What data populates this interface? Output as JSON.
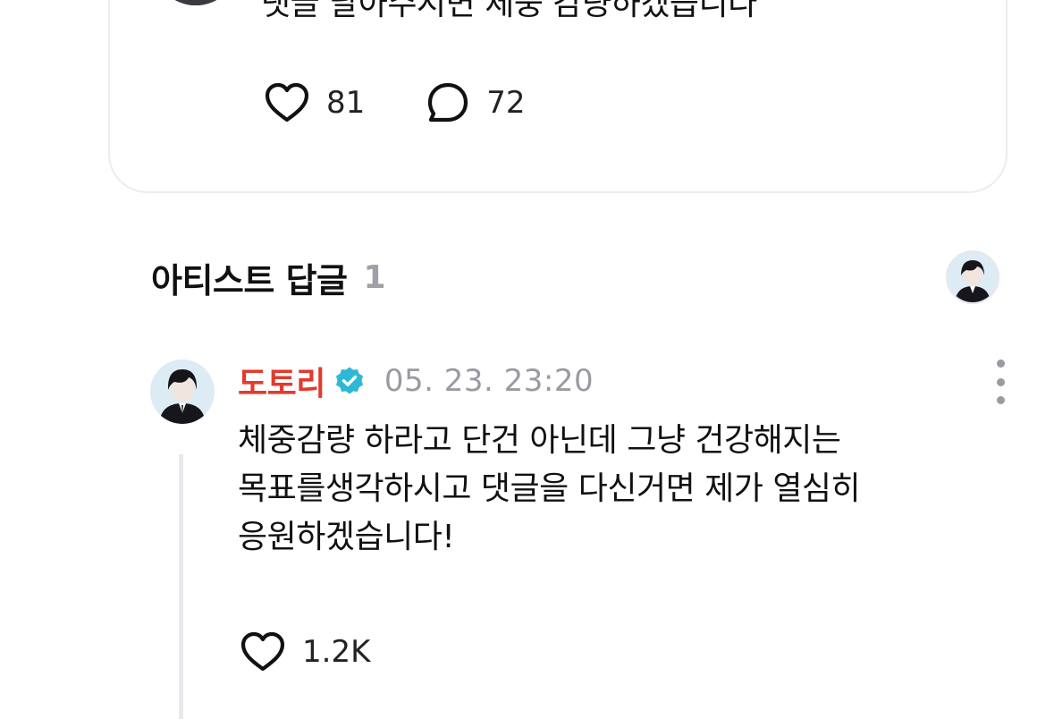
{
  "post": {
    "text": "댓글 달아주시면 체중 감량하겠습니다",
    "likes": "81",
    "comments": "72"
  },
  "artist_replies": {
    "title": "아티스트 답글",
    "count": "1"
  },
  "reply": {
    "author": "도토리",
    "timestamp": "05. 23. 23:20",
    "lines": [
      "체중감량 하라고 단건 아닌데 그냥 건강해지는",
      "목표를생각하시고 댓글을 다신거면 제가 열심히",
      "응원하겠습니다!"
    ],
    "likes": "1.2K"
  },
  "colors": {
    "author_name": "#e23a2c",
    "verified_badge": "#2fb8d6",
    "muted_text": "#9a9aa2",
    "border": "#ececf0"
  },
  "icons": {
    "like": "heart-outline-icon",
    "comment": "speech-bubble-icon",
    "verified": "verified-badge-icon",
    "more": "vertical-ellipsis-icon"
  }
}
